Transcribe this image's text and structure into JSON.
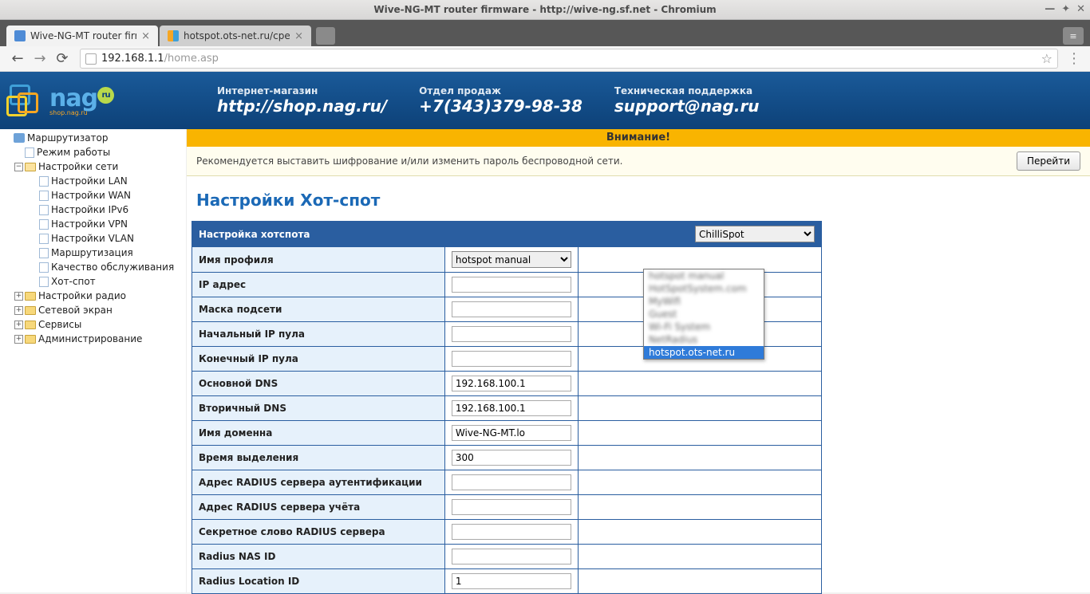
{
  "window_title": "Wive-NG-MT router firmware - http://wive-ng.sf.net - Chromium",
  "tabs": [
    {
      "label": "Wive-NG-MT router firm"
    },
    {
      "label": "hotspot.ots-net.ru/cpe/"
    }
  ],
  "url_host": "192.168.1.1",
  "url_path": "/home.asp",
  "banner": {
    "col1_top": "Интернет-магазин",
    "col1_bot": "http://shop.nag.ru/",
    "col2_top": "Отдел продаж",
    "col2_bot": "+7(343)379-98-38",
    "col3_top": "Техническая поддержка",
    "col3_bot": "support@nag.ru",
    "logo_sub": "shop.nag.ru"
  },
  "sidebar": {
    "root": "Маршрутизатор",
    "mode": "Режим работы",
    "net": "Настройки сети",
    "net_items": [
      "Настройки LAN",
      "Настройки WAN",
      "Настройки IPv6",
      "Настройки VPN",
      "Настройки VLAN",
      "Маршрутизация",
      "Качество обслуживания",
      "Хот-спот"
    ],
    "radio": "Настройки радио",
    "fw": "Сетевой экран",
    "svc": "Сервисы",
    "admin": "Администрирование"
  },
  "notice": {
    "title": "Внимание!",
    "text": "Рекомендуется выставить шифрование и/или изменить пароль беспроводной сети.",
    "button": "Перейти"
  },
  "page_title": "Настройки Хот-спот",
  "table": {
    "header": "Настройка хотспота",
    "mode_select": "ChilliSpot",
    "rows": [
      {
        "label": "Имя профиля",
        "value": "hotspot manual",
        "type": "select"
      },
      {
        "label": "IP адрес",
        "value": "",
        "type": "text"
      },
      {
        "label": "Маска подсети",
        "value": "",
        "type": "text"
      },
      {
        "label": "Начальный IP пула",
        "value": "",
        "type": "text"
      },
      {
        "label": "Конечный IP пула",
        "value": "",
        "type": "text"
      },
      {
        "label": "Основной DNS",
        "value": "192.168.100.1",
        "type": "text"
      },
      {
        "label": "Вторичный DNS",
        "value": "192.168.100.1",
        "type": "text"
      },
      {
        "label": "Имя доменна",
        "value": "Wive-NG-MT.lo",
        "type": "text"
      },
      {
        "label": "Время выделения",
        "value": "300",
        "type": "text"
      },
      {
        "label": "Адрес RADIUS сервера аутентификации",
        "value": "",
        "type": "text"
      },
      {
        "label": "Адрес RADIUS сервера учёта",
        "value": "",
        "type": "text"
      },
      {
        "label": "Секретное слово RADIUS сервера",
        "value": "",
        "type": "text"
      },
      {
        "label": "Radius NAS ID",
        "value": "",
        "type": "text"
      },
      {
        "label": "Radius Location ID",
        "value": "1",
        "type": "text"
      }
    ],
    "dropdown_highlight": "hotspot.ots-net.ru"
  }
}
